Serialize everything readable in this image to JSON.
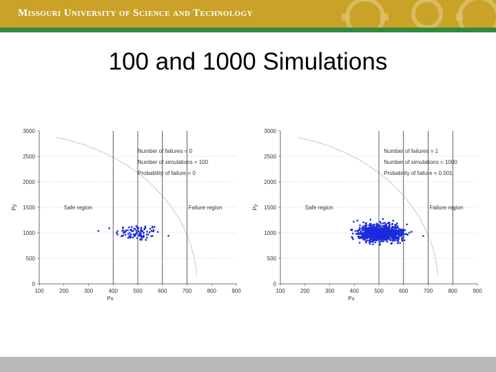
{
  "header": {
    "university": "Missouri University of Science and Technology",
    "colors": {
      "gold": "#c9a227",
      "green": "#2e8b3e"
    },
    "logo_icon": "gear-icon"
  },
  "slide": {
    "title": "100 and 1000 Simulations"
  },
  "footer": {
    "color": "#b8b8b8"
  },
  "chart_data": [
    {
      "type": "scatter",
      "xlabel": "Px",
      "ylabel": "Py",
      "xlim": [
        100,
        900
      ],
      "ylim": [
        0,
        3000
      ],
      "xticks": [
        100,
        200,
        300,
        400,
        500,
        600,
        700,
        800,
        900
      ],
      "yticks": [
        0,
        500,
        1000,
        1500,
        2000,
        2500,
        3000
      ],
      "vertical_gridlines": [
        400,
        500,
        600,
        700
      ],
      "horizontal_gridlines": [
        500,
        1000,
        1500,
        2000,
        2500
      ],
      "annotations": [
        "Number of failures = 0",
        "Number of simulations = 100",
        "Probability of failure = 0"
      ],
      "region_labels": {
        "safe": "Safe region",
        "failure": "Failure region"
      },
      "limit_state": "px^2/740^2 + py^2/2950^2 = 1",
      "point_color": "#1a2adb",
      "n_points": 100,
      "cluster": {
        "x_mean": 500,
        "x_sd": 45,
        "y_mean": 1000,
        "y_sd": 80
      }
    },
    {
      "type": "scatter",
      "xlabel": "Px",
      "ylabel": "Py",
      "xlim": [
        100,
        900
      ],
      "ylim": [
        0,
        3000
      ],
      "xticks": [
        100,
        200,
        300,
        400,
        500,
        600,
        700,
        800,
        900
      ],
      "yticks": [
        0,
        500,
        1000,
        1500,
        2000,
        2500,
        3000
      ],
      "vertical_gridlines": [
        500,
        600,
        700,
        800
      ],
      "horizontal_gridlines": [
        500,
        1000,
        1500,
        2000,
        2500
      ],
      "annotations": [
        "Number of failures = 1",
        "Number of simulations = 1000",
        "Probability of failure = 0.001"
      ],
      "region_labels": {
        "safe": "Safe region",
        "failure": "Failure region"
      },
      "limit_state": "px^2/740^2 + py^2/2950^2 = 1",
      "point_color": "#1a2adb",
      "n_points": 1000,
      "cluster": {
        "x_mean": 510,
        "x_sd": 45,
        "y_mean": 1000,
        "y_sd": 80
      }
    }
  ]
}
